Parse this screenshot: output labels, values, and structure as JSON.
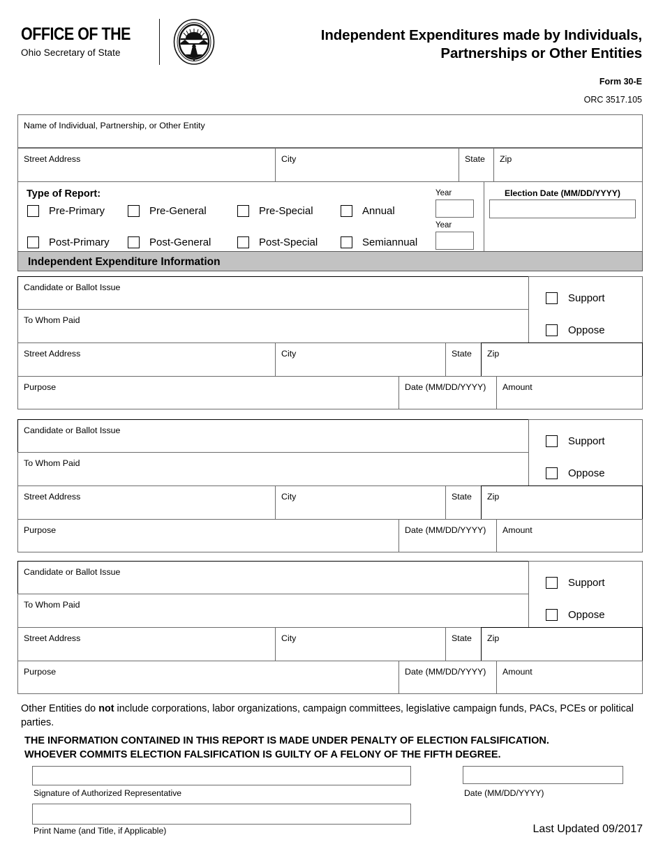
{
  "header": {
    "brand_line1": "OFFICE OF THE",
    "brand_line2": "Ohio Secretary of State",
    "seal_icon": "ohio-secretary-of-state-seal",
    "seal_text_outer": "THE SEAL OF THE SECRETARY OF STATE OF OHIO",
    "title": "Independent Expenditures made by Individuals, Partnerships or Other Entities",
    "title_line1": "Independent Expenditures made by Individuals,",
    "title_line2": "Partnerships or Other Entities",
    "form_number": "Form 30-E",
    "orc": "ORC 3517.105"
  },
  "identity": {
    "name_label": "Name of Individual, Partnership, or Other Entity",
    "street_label": "Street Address",
    "city_label": "City",
    "state_label": "State",
    "zip_label": "Zip",
    "name_value": "",
    "street_value": "",
    "city_value": "",
    "state_value": "",
    "zip_value": ""
  },
  "type_of_report": {
    "title": "Type of Report:",
    "row1": [
      {
        "label": "Pre-Primary",
        "checked": false
      },
      {
        "label": "Pre-General",
        "checked": false
      },
      {
        "label": "Pre-Special",
        "checked": false
      },
      {
        "label": "Annual",
        "checked": false
      }
    ],
    "row2": [
      {
        "label": "Post-Primary",
        "checked": false
      },
      {
        "label": "Post-General",
        "checked": false
      },
      {
        "label": "Post-Special",
        "checked": false
      },
      {
        "label": "Semiannual",
        "checked": false
      }
    ],
    "year_label_1": "Year",
    "year_label_2": "Year",
    "year_value_1": "",
    "year_value_2": "",
    "election_date_label": "Election Date (MM/DD/YYYY)",
    "election_date_value": ""
  },
  "section_header": "Independent Expenditure Information",
  "expenditure_labels": {
    "candidate": "Candidate or Ballot Issue",
    "to_whom_paid": "To Whom Paid",
    "street": "Street Address",
    "city": "City",
    "state": "State",
    "zip": "Zip",
    "purpose": "Purpose",
    "date": "Date (MM/DD/YYYY)",
    "amount": "Amount",
    "support": "Support",
    "oppose": "Oppose"
  },
  "expenditures": [
    {
      "candidate": "",
      "to_whom_paid": "",
      "street": "",
      "city": "",
      "state": "",
      "zip": "",
      "purpose": "",
      "date": "",
      "amount": "",
      "support_checked": false,
      "oppose_checked": false
    },
    {
      "candidate": "",
      "to_whom_paid": "",
      "street": "",
      "city": "",
      "state": "",
      "zip": "",
      "purpose": "",
      "date": "",
      "amount": "",
      "support_checked": false,
      "oppose_checked": false
    },
    {
      "candidate": "",
      "to_whom_paid": "",
      "street": "",
      "city": "",
      "state": "",
      "zip": "",
      "purpose": "",
      "date": "",
      "amount": "",
      "support_checked": false,
      "oppose_checked": false
    }
  ],
  "footer": {
    "note_pre": "Other Entities do ",
    "note_bold": "not",
    "note_post": " include corporations, labor organizations, campaign committees, legislative campaign funds, PACs, PCEs or political parties.",
    "penalty_line1": "THE INFORMATION CONTAINED IN THIS REPORT IS MADE UNDER PENALTY OF ELECTION FALSIFICATION.",
    "penalty_line2": "WHOEVER COMMITS ELECTION FALSIFICATION IS GUILTY OF A FELONY OF THE FIFTH DEGREE.",
    "signature_caption": "Signature of Authorized Representative",
    "date_caption": "Date (MM/DD/YYYY)",
    "print_name_caption": "Print Name (and Title, if Applicable)",
    "signature_value": "",
    "date_value": "",
    "print_name_value": "",
    "last_updated": "Last Updated 09/2017"
  },
  "colors": {
    "section_header_bg": "#c2c2c2",
    "border": "#6b6b6b",
    "border_strong": "#000000"
  }
}
